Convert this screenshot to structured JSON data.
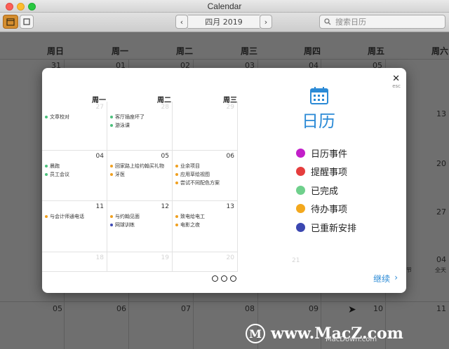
{
  "window": {
    "title": "Calendar"
  },
  "toolbar": {
    "month": "四月 2019",
    "search_placeholder": "搜索日历"
  },
  "background": {
    "weekdays": [
      "周日",
      "周一",
      "周二",
      "周三",
      "周四",
      "周五",
      "周六"
    ],
    "row1": [
      "31",
      "01",
      "02",
      "03",
      "04",
      "05"
    ],
    "right_col": [
      "13",
      "20",
      "27"
    ],
    "row_last": [
      "05",
      "06",
      "07",
      "08",
      "09",
      "10",
      "11"
    ],
    "sat_04": "04",
    "sat_04_label": "全天",
    "fri_small": "节"
  },
  "modal": {
    "close": "✕",
    "esc": "esc",
    "mini_headers": [
      "周一",
      "周二",
      "周三"
    ],
    "cells": [
      {
        "num": "27",
        "faded": true,
        "events": [
          {
            "text": "文章校对",
            "color": "#4cc07c"
          }
        ]
      },
      {
        "num": "28",
        "faded": true,
        "events": [
          {
            "text": "客厅插座坏了",
            "color": "#4cc07c"
          },
          {
            "text": "游泳课",
            "color": "#4cc07c"
          }
        ]
      },
      {
        "num": "29",
        "faded": true,
        "events": []
      },
      {
        "num": "04",
        "faded": false,
        "events": [
          {
            "text": "晨跑",
            "color": "#4cc07c"
          },
          {
            "text": "员工会议",
            "color": "#4cc07c"
          }
        ]
      },
      {
        "num": "05",
        "faded": false,
        "events": [
          {
            "text": "回家路上给约翰买礼物",
            "color": "#f0a020"
          },
          {
            "text": "牙医",
            "color": "#f0a020"
          }
        ]
      },
      {
        "num": "06",
        "faded": false,
        "events": [
          {
            "text": "业余项目",
            "color": "#f0a020"
          },
          {
            "text": "应用草绘视图",
            "color": "#f0a020"
          },
          {
            "text": "尝试不同配色方案",
            "color": "#f0a020"
          }
        ]
      },
      {
        "num": "11",
        "faded": false,
        "events": [
          {
            "text": "与会计师通电话",
            "color": "#f0a020"
          }
        ]
      },
      {
        "num": "12",
        "faded": false,
        "events": [
          {
            "text": "与约翰见面",
            "color": "#f0a020"
          },
          {
            "text": "网球训练",
            "color": "#3f4bb5"
          }
        ]
      },
      {
        "num": "13",
        "faded": false,
        "events": [
          {
            "text": "致电给电工",
            "color": "#f0a020"
          },
          {
            "text": "电影之夜",
            "color": "#f0a020"
          }
        ]
      },
      {
        "num": "18",
        "faded": true,
        "events": []
      },
      {
        "num": "19",
        "faded": true,
        "events": []
      },
      {
        "num": "20",
        "faded": true,
        "events": []
      }
    ],
    "extra_num": "21",
    "title": "日历",
    "legend": [
      {
        "label": "日历事件",
        "color": "#c21fc9"
      },
      {
        "label": "提醒事项",
        "color": "#e53d3d"
      },
      {
        "label": "已完成",
        "color": "#6fd08c"
      },
      {
        "label": "待办事项",
        "color": "#f3a81d"
      },
      {
        "label": "已重新安排",
        "color": "#3b47b0"
      }
    ],
    "continue_label": "继续",
    "continue_arrow": "›"
  },
  "watermark": {
    "text": "www.MacZ.com",
    "logo": "M",
    "sub": "MacDown.com"
  }
}
